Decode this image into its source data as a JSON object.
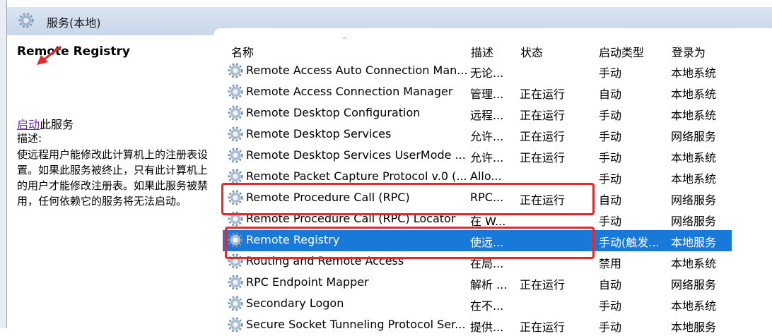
{
  "topbar": {
    "title": "服务(本地)",
    "icon": "gear-icon"
  },
  "left_pane": {
    "service_name": "Remote Registry",
    "action_link": "启动",
    "action_suffix": "此服务",
    "description_label": "描述:",
    "description": "使远程用户能修改此计算机上的注册表设置。如果此服务被终止，只有此计算机上的用户才能修改注册表。如果此服务被禁用，任何依赖它的服务将无法启动。"
  },
  "table": {
    "columns": {
      "name": "名称",
      "desc": "描述",
      "status": "状态",
      "start": "启动类型",
      "logon": "登录为"
    },
    "rows": [
      {
        "name": "Remote Access Auto Connection Man...",
        "desc": "无论...",
        "status": "",
        "start": "手动",
        "logon": "本地系统"
      },
      {
        "name": "Remote Access Connection Manager",
        "desc": "管理...",
        "status": "正在运行",
        "start": "自动",
        "logon": "本地系统"
      },
      {
        "name": "Remote Desktop Configuration",
        "desc": "远程...",
        "status": "正在运行",
        "start": "手动",
        "logon": "本地系统"
      },
      {
        "name": "Remote Desktop Services",
        "desc": "允许...",
        "status": "正在运行",
        "start": "手动",
        "logon": "网络服务"
      },
      {
        "name": "Remote Desktop Services UserMode ...",
        "desc": "允许...",
        "status": "正在运行",
        "start": "手动",
        "logon": "本地系统"
      },
      {
        "name": "Remote Packet Capture Protocol v.0 (...",
        "desc": "Allo...",
        "status": "",
        "start": "手动",
        "logon": "本地系统"
      },
      {
        "name": "Remote Procedure Call (RPC)",
        "desc": "RPC...",
        "status": "正在运行",
        "start": "自动",
        "logon": "网络服务"
      },
      {
        "name": "Remote Procedure Call (RPC) Locator",
        "desc": "在 W...",
        "status": "",
        "start": "手动",
        "logon": "网络服务"
      },
      {
        "name": "Remote Registry",
        "desc": "使远...",
        "status": "",
        "start": "手动(触发...",
        "logon": "本地服务"
      },
      {
        "name": "Routing and Remote Access",
        "desc": "在局...",
        "status": "",
        "start": "禁用",
        "logon": "本地系统"
      },
      {
        "name": "RPC Endpoint Mapper",
        "desc": "解析 ...",
        "status": "正在运行",
        "start": "自动",
        "logon": "网络服务"
      },
      {
        "name": "Secondary Logon",
        "desc": "在不...",
        "status": "",
        "start": "手动",
        "logon": "本地系统"
      },
      {
        "name": "Secure Socket Tunneling Protocol Ser...",
        "desc": "提供...",
        "status": "正在运行",
        "start": "手动",
        "logon": "本地服务"
      }
    ]
  },
  "selected_row": "Remote Registry",
  "colors": {
    "selection": "#1979d8",
    "highlight_box": "#e4292b",
    "link": "#6e2bb1"
  }
}
